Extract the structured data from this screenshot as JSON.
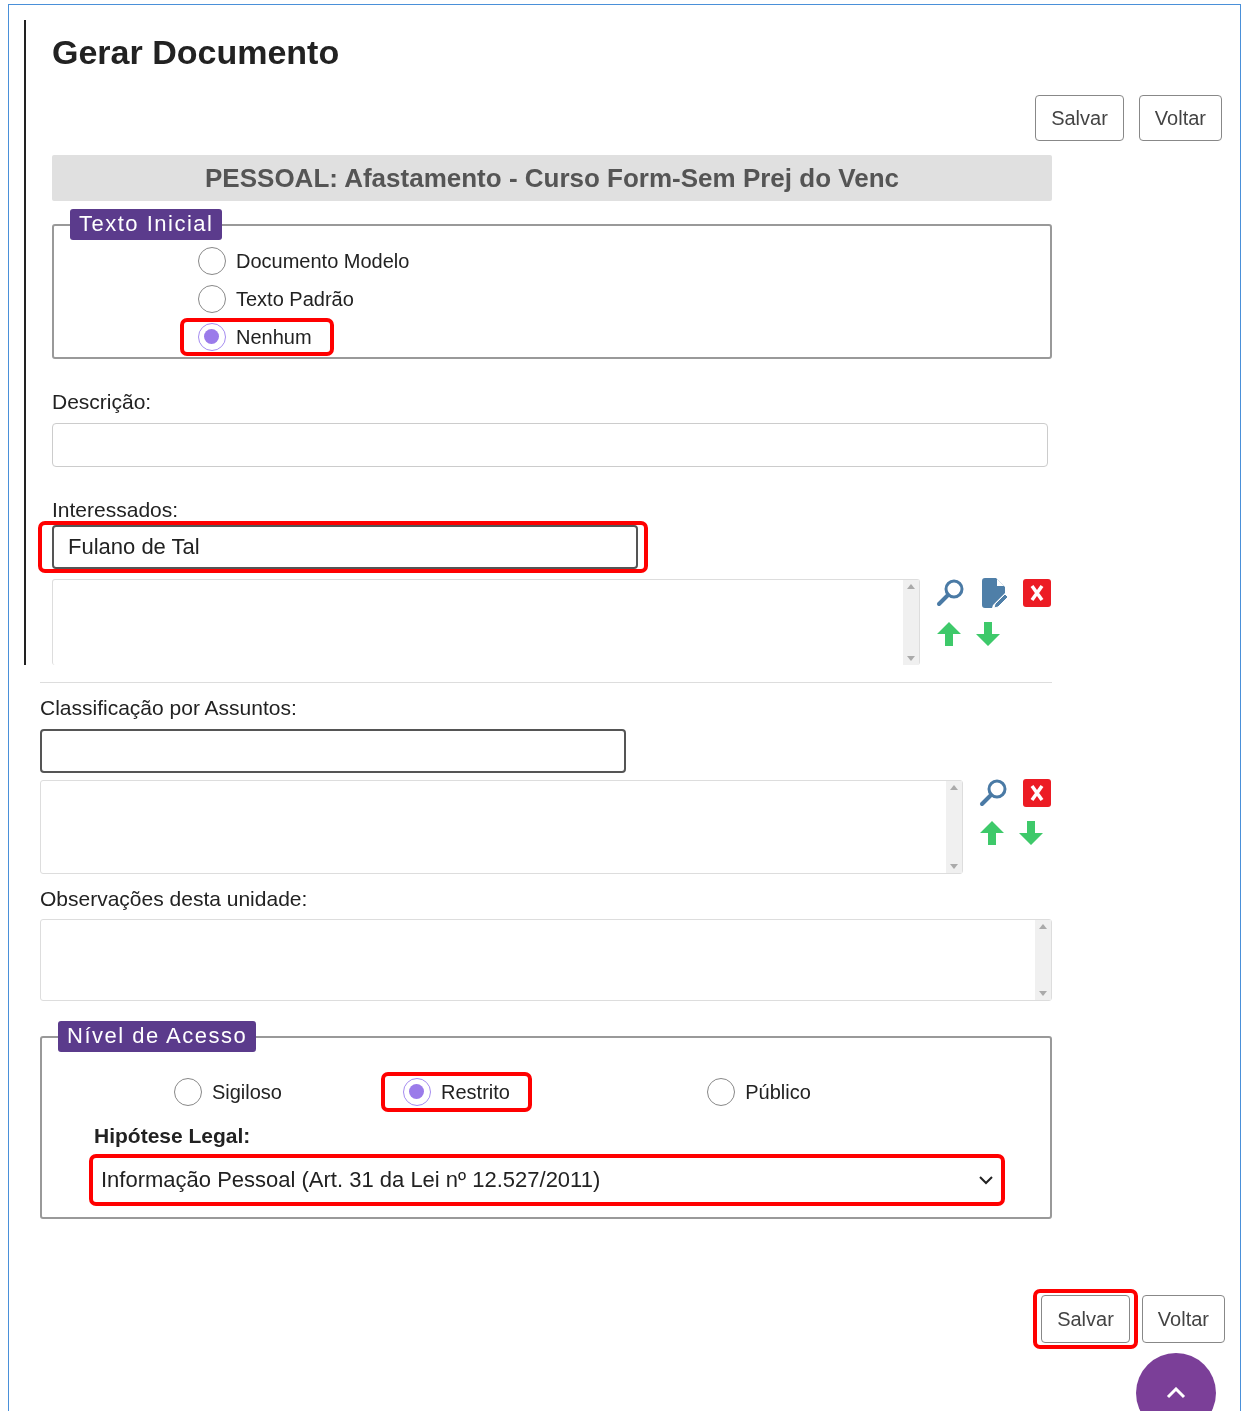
{
  "title": "Gerar Documento",
  "top_buttons": [
    {
      "label": "Salvar",
      "highlighted": false
    },
    {
      "label": "Voltar",
      "highlighted": false
    }
  ],
  "document_type": "PESSOAL: Afastamento - Curso Form-Sem Prej do Venc",
  "texto_inicial": {
    "legend": "Texto Inicial",
    "options": [
      {
        "label": "Documento Modelo",
        "selected": false,
        "highlighted": false
      },
      {
        "label": "Texto Padrão",
        "selected": false,
        "highlighted": false
      },
      {
        "label": "Nenhum",
        "selected": true,
        "highlighted": true
      }
    ]
  },
  "descricao": {
    "label": "Descrição:"
  },
  "interessados": {
    "label": "Interessados:",
    "value": "Fulano de Tal",
    "highlighted": true
  },
  "classificacao": {
    "label": "Classificação por Assuntos:"
  },
  "observacoes": {
    "label": "Observações desta unidade:"
  },
  "nivel_acesso": {
    "legend": "Nível de Acesso",
    "options": [
      {
        "label": "Sigiloso",
        "selected": false,
        "highlighted": false
      },
      {
        "label": "Restrito",
        "selected": true,
        "highlighted": true
      },
      {
        "label": "Público",
        "selected": false,
        "highlighted": false
      }
    ],
    "hipotese_label": "Hipótese Legal:",
    "hipotese_value": "Informação Pessoal (Art. 31 da Lei nº 12.527/2011)",
    "hipotese_highlighted": true
  },
  "bottom_buttons": [
    {
      "label": "Salvar",
      "highlighted": true
    },
    {
      "label": "Voltar",
      "highlighted": false
    }
  ]
}
